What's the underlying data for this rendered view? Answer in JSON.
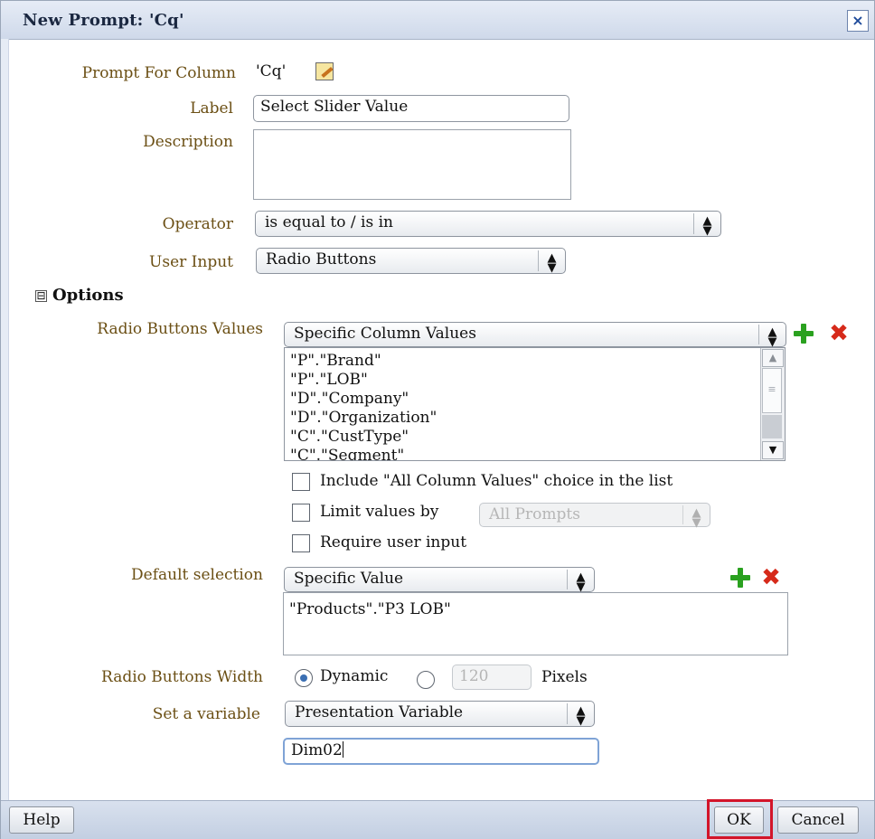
{
  "dialog": {
    "title": "New Prompt: 'Cq'",
    "close_glyph": "×"
  },
  "prompt_for_column": {
    "label": "Prompt For Column",
    "value": "'Cq'",
    "icon": "edit-icon"
  },
  "label_field": {
    "label": "Label",
    "value": "Select Slider Value"
  },
  "description": {
    "label": "Description",
    "value": ""
  },
  "operator": {
    "label": "Operator",
    "value": "is equal to / is in"
  },
  "user_input": {
    "label": "User Input",
    "value": "Radio Buttons"
  },
  "options": {
    "toggle": "⊟",
    "label": "Options"
  },
  "radio_values": {
    "label": "Radio Buttons Values",
    "value": "Specific Column Values",
    "items": [
      "\"P\".\"Brand\"",
      "\"P\".\"LOB\"",
      "\"D\".\"Company\"",
      "\"D\".\"Organization\"",
      "\"C\".\"CustType\"",
      "\"C\".\"Segment\""
    ]
  },
  "include_all": {
    "label": "Include \"All Column Values\" choice in the list",
    "checked": false
  },
  "limit_values": {
    "label": "Limit values by",
    "select_value": "All Prompts",
    "checked": false
  },
  "require_input": {
    "label": "Require user input",
    "checked": false
  },
  "default_selection": {
    "label": "Default selection",
    "value": "Specific Value",
    "content": "\"Products\".\"P3 LOB\""
  },
  "width": {
    "label": "Radio Buttons Width",
    "dynamic_label": "Dynamic",
    "pixels_value": "120",
    "pixels_label": "Pixels",
    "selected": "Dynamic"
  },
  "variable": {
    "label": "Set a variable",
    "value": "Presentation Variable",
    "name": "Dim02"
  },
  "footer": {
    "help": "Help",
    "ok": "OK",
    "cancel": "Cancel"
  },
  "colors": {
    "label_brown": "#6b4f14",
    "title_bar": "#cfd9ea",
    "highlight": "#d3152a",
    "add_green": "#2aa11f",
    "remove_red": "#d62a1a"
  }
}
